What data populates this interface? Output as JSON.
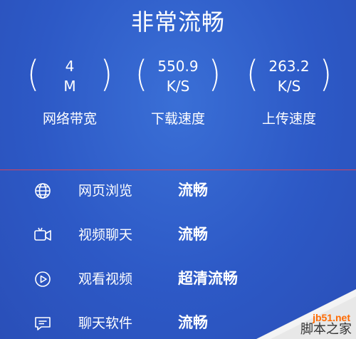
{
  "header": {
    "title": "非常流畅"
  },
  "metrics": [
    {
      "value": "4",
      "unit": "M",
      "label": "网络带宽"
    },
    {
      "value": "550.9",
      "unit": "K/S",
      "label": "下载速度"
    },
    {
      "value": "263.2",
      "unit": "K/S",
      "label": "上传速度"
    }
  ],
  "services": [
    {
      "icon": "globe-icon",
      "name": "网页浏览",
      "status": "流畅"
    },
    {
      "icon": "video-camera-icon",
      "name": "视频聊天",
      "status": "流畅"
    },
    {
      "icon": "play-icon",
      "name": "观看视频",
      "status": "超清流畅"
    },
    {
      "icon": "chat-bubble-icon",
      "name": "聊天软件",
      "status": "流畅"
    }
  ],
  "watermark": {
    "site": "jb51.net",
    "name": "脚本之家"
  },
  "colors": {
    "background": "#2d59c6",
    "divider": "#d9435a",
    "text": "#ffffff"
  }
}
